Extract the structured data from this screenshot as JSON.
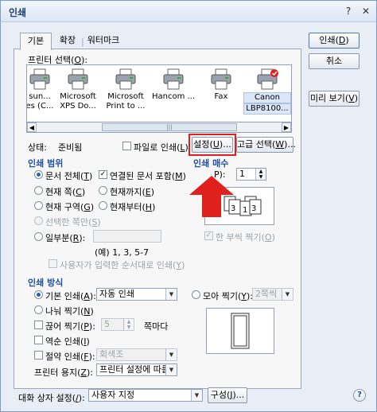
{
  "window": {
    "title": "인쇄",
    "help_glyph": "?",
    "close_glyph": "✕"
  },
  "tabs": [
    {
      "label": "기본"
    },
    {
      "label": "확장"
    },
    {
      "label": "워터마크"
    }
  ],
  "printer_select": {
    "label": "프린터 선택(",
    "key": "O",
    "suffix": "):",
    "printers": [
      {
        "name": "sun...",
        "name2": "es (C..."
      },
      {
        "name": "Microsoft",
        "name2": "XPS Do..."
      },
      {
        "name": "Microsoft",
        "name2": "Print to ..."
      },
      {
        "name": "Hancom ...",
        "name2": ""
      },
      {
        "name": "Fax",
        "name2": ""
      },
      {
        "name": "Canon",
        "name2": "LBP8100..."
      }
    ],
    "scroll_left": "◀",
    "scroll_right": "▶",
    "scroll_grip": "|||"
  },
  "status": {
    "label": "상태:",
    "value": "준비됨"
  },
  "print_to_file": {
    "label": "파일로 인쇄(",
    "key": "L",
    "suffix": ")",
    "checked": false
  },
  "buttons": {
    "settings": {
      "label": "설정(",
      "key": "U",
      "suffix": ")..."
    },
    "advanced": {
      "label": "고급 선택(",
      "key": "W",
      "suffix": ")..."
    },
    "print": {
      "label": "인쇄(",
      "key": "D",
      "suffix": ")"
    },
    "cancel": {
      "label": "취소"
    },
    "preview": {
      "label": "미리 보기(",
      "key": "V",
      "suffix": ")"
    },
    "config": {
      "label": "구성(",
      "key": "J",
      "suffix": ")..."
    },
    "help": {
      "label": "?"
    }
  },
  "print_range": {
    "title": "인쇄 범위",
    "all_doc": {
      "label": "문서 전체(",
      "key": "T",
      "suffix": ")",
      "selected": true
    },
    "linked_docs": {
      "label": "연결된 문서 포함(",
      "key": "M",
      "suffix": ")",
      "checked": true
    },
    "current_page": {
      "label": "현재 쪽(",
      "key": "C",
      "suffix": ")"
    },
    "until_current": {
      "label": "현재까지(",
      "key": "E",
      "suffix": ")"
    },
    "current_section": {
      "label": "현재 구역(",
      "key": "G",
      "suffix": ")"
    },
    "from_current": {
      "label": "현재부터(",
      "key": "H",
      "suffix": ")"
    },
    "selected_pages": {
      "label": "선택한 쪽만(",
      "key": "S",
      "suffix": ")"
    },
    "partial": {
      "label": "일부분(",
      "key": "R",
      "suffix": "):"
    },
    "example": "(예) 1, 3, 5-7",
    "user_order": {
      "label": "사용자가 입력한 순서대로 인쇄(",
      "key": "Y",
      "suffix": ")"
    }
  },
  "copies": {
    "title": "인쇄 매수",
    "label_suffix": "P):",
    "value": "1",
    "collate": {
      "label": "한 부씩 찍기(",
      "key": "O",
      "suffix": ")",
      "checked": true
    },
    "page_a": "1",
    "page_b": "2",
    "page_c": "3"
  },
  "print_method": {
    "title": "인쇄 방식",
    "default": {
      "label": "기본 인쇄(",
      "key": "A",
      "suffix": "):",
      "value": "자동 인쇄",
      "selected": true
    },
    "collect": {
      "label": "모아 찍기(",
      "key": "Y",
      "suffix": "):",
      "value": "2쪽씩"
    },
    "split": {
      "label": "나눠 찍기(",
      "key": "N",
      "suffix": ")"
    },
    "cut": {
      "label": "끊어 찍기(",
      "key": "P",
      "suffix": "):",
      "value": "5",
      "unit": "쪽마다"
    },
    "reverse": {
      "label": "역순 인쇄(",
      "key": "I",
      "suffix": ")"
    },
    "saving": {
      "label": "절약 인쇄(",
      "key": "F",
      "suffix": "):",
      "value": "회색조"
    },
    "paper": {
      "label": "프린터 용지(",
      "key": "Z",
      "suffix": "):",
      "value": "프린터 설정에 따름"
    }
  },
  "dialog_settings": {
    "label": "대화 상자 설정(",
    "key": "/",
    "suffix": "):",
    "value": "사용자 지정"
  },
  "colors": {
    "accent": "#1d4e9a",
    "arrow": "#e0201c"
  }
}
